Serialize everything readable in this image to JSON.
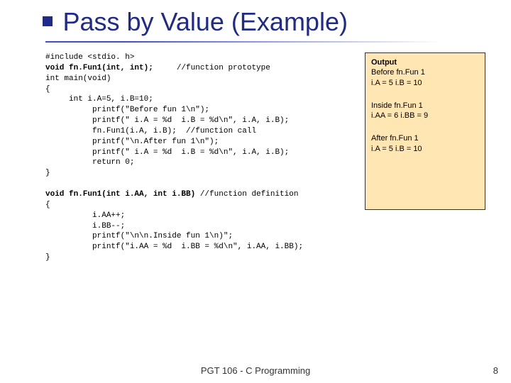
{
  "slide": {
    "title": "Pass by Value (Example)"
  },
  "code": {
    "l1": "#include <stdio. h>",
    "l2a": "void fn.Fun1(int, int);",
    "l2b": "     //function prototype",
    "l3": "int main(void)",
    "l4": "{",
    "l5": "     int i.A=5, i.B=10;",
    "l6": "          printf(\"Before fun 1\\n\");",
    "l7": "          printf(\" i.A = %d  i.B = %d\\n\", i.A, i.B);",
    "l8a": "          fn.Fun1(i.A, i.B);",
    "l8b": "  //function call",
    "l9": "          printf(\"\\n.After fun 1\\n\");",
    "l10": "          printf(\" i.A = %d  i.B = %d\\n\", i.A, i.B);",
    "l11": "          return 0;",
    "l12": "}",
    "l13a": "void fn.Fun1(int i.AA, int i.BB)",
    "l13b": " //function definition",
    "l14": "{",
    "l15": "          i.AA++;",
    "l16": "          i.BB--;",
    "l17": "          printf(\"\\n\\n.Inside fun 1\\n)\";",
    "l18": "          printf(\"i.AA = %d  i.BB = %d\\n\", i.AA, i.BB);",
    "l19": "}"
  },
  "output": {
    "heading": "Output",
    "g1l1": "Before fn.Fun 1",
    "g1l2": "i.A = 5 i.B = 10",
    "g2l1": "Inside fn.Fun 1",
    "g2l2": "i.AA = 6 i.BB = 9",
    "g3l1": "After fn.Fun 1",
    "g3l2": "i.A = 5 i.B = 10"
  },
  "footer": {
    "text": "PGT 106 - C Programming",
    "page": "8"
  }
}
